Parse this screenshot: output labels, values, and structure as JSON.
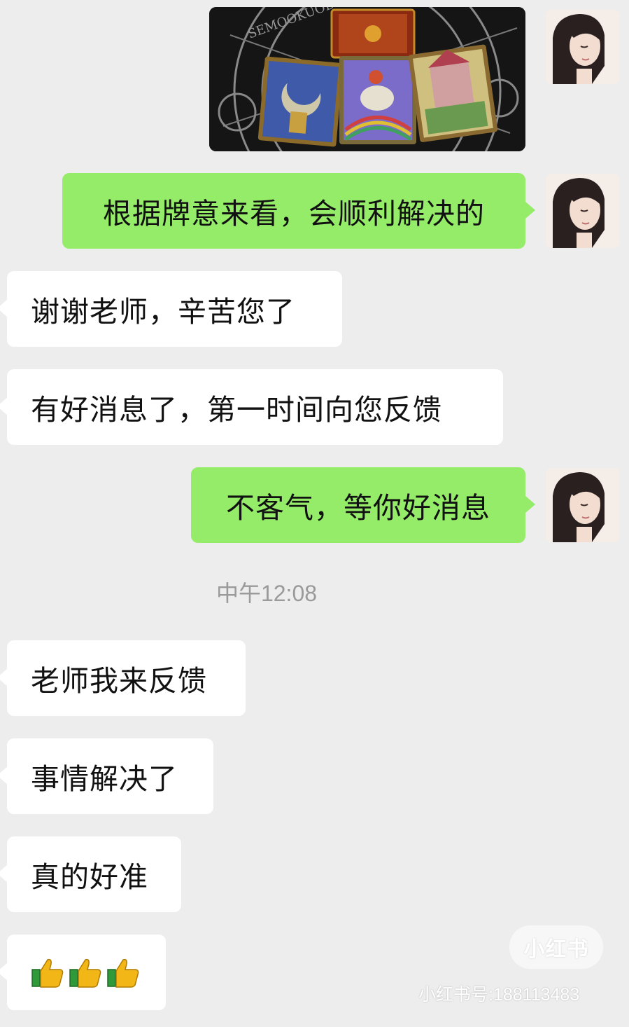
{
  "conversation": {
    "messages": [
      {
        "side": "out",
        "type": "image",
        "image_icon": "tarot-cards-photo"
      },
      {
        "side": "out",
        "type": "text",
        "text": "根据牌意来看，会顺利解决的"
      },
      {
        "side": "in",
        "type": "text",
        "text": "谢谢老师，辛苦您了"
      },
      {
        "side": "in",
        "type": "text",
        "text": "有好消息了，第一时间向您反馈"
      },
      {
        "side": "out",
        "type": "text",
        "text": "不客气，等你好消息"
      },
      {
        "side": "in",
        "type": "text",
        "text": "老师我来反馈"
      },
      {
        "side": "in",
        "type": "text",
        "text": "事情解决了"
      },
      {
        "side": "in",
        "type": "text",
        "text": "真的好准"
      },
      {
        "side": "in",
        "type": "emoji",
        "emoji_icon": "thumbs-up-icon",
        "count": 3
      }
    ],
    "timestamp": "中午12:08"
  },
  "watermark": {
    "logo_text": "小红书",
    "id_text": "小红书号:188113483"
  },
  "colors": {
    "background": "#ededed",
    "outgoing_bubble": "#95ec69",
    "incoming_bubble": "#ffffff",
    "timestamp_text": "#9a9a9a"
  }
}
